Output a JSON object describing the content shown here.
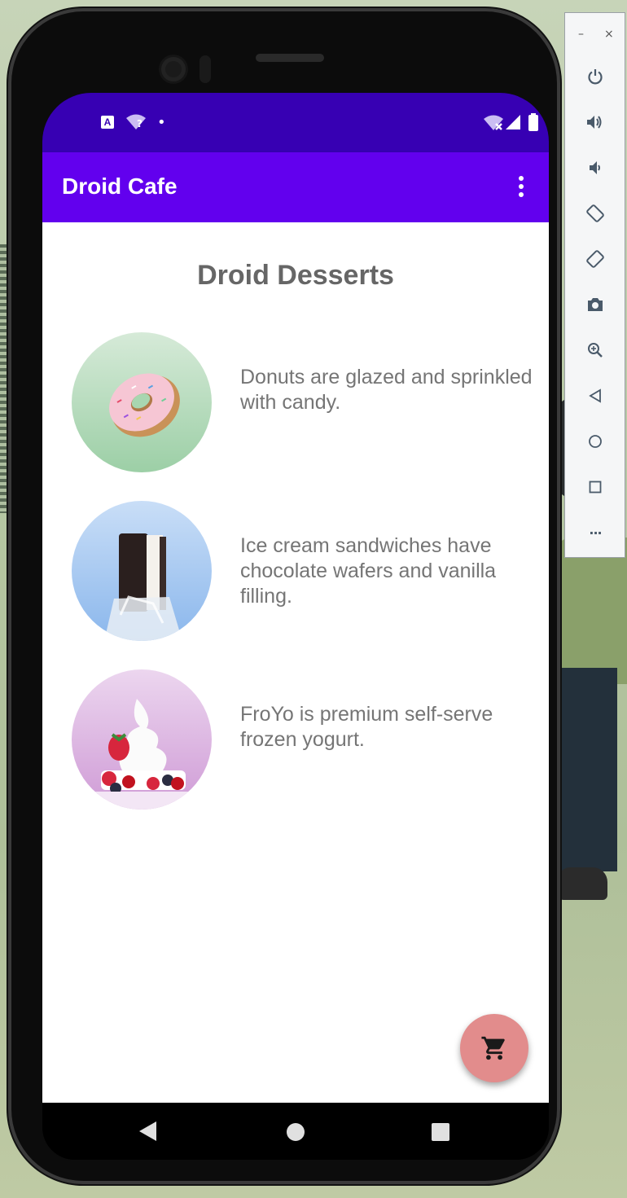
{
  "status_bar": {
    "left_icons": [
      "accessibility-icon",
      "wifi-question-icon",
      "notification-dot-icon"
    ],
    "right_icons": [
      "wifi-x-icon",
      "signal-icon",
      "battery-icon"
    ],
    "wifi_question_mark": "?",
    "dot": "•",
    "a11y_letter": "A"
  },
  "app_bar": {
    "title": "Droid Cafe",
    "overflow_icon": "more-vert-icon"
  },
  "content": {
    "heading": "Droid Desserts",
    "items": [
      {
        "name": "donut",
        "description": "Donuts are glazed and sprinkled with candy."
      },
      {
        "name": "ice-cream-sandwich",
        "description": "Ice cream sandwiches have chocolate wafers and vanilla filling."
      },
      {
        "name": "froyo",
        "description": "FroYo is premium self-serve frozen yogurt."
      }
    ]
  },
  "fab": {
    "icon": "shopping-cart-icon"
  },
  "nav_bar": {
    "icons": [
      "back-icon",
      "home-icon",
      "recents-icon"
    ]
  },
  "emulator_toolbar": {
    "minimize": "–",
    "close": "×",
    "more": "···",
    "icons": [
      "power-icon",
      "volume-up-icon",
      "volume-down-icon",
      "rotate-left-icon",
      "rotate-right-icon",
      "camera-icon",
      "zoom-icon",
      "back-icon",
      "home-icon",
      "overview-icon",
      "more-icon"
    ]
  },
  "colors": {
    "status_bar": "#3700b3",
    "app_bar": "#6200ee",
    "fab": "#e28c8c",
    "text_secondary": "#757575"
  }
}
